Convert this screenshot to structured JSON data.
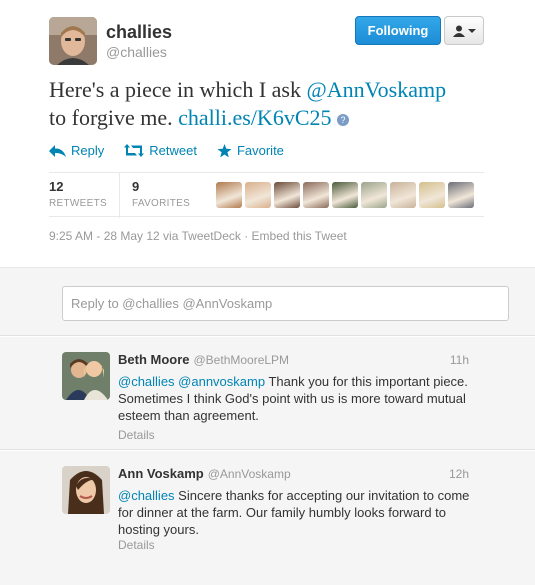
{
  "main_tweet": {
    "author_name": "challies",
    "author_handle": "@challies",
    "following_label": "Following",
    "text_part1": "Here's a piece in which I ask ",
    "mention": "@AnnVoskamp",
    "text_part2": "to forgive me. ",
    "link": "challi.es/K6vC25",
    "actions": {
      "reply": "Reply",
      "retweet": "Retweet",
      "favorite": "Favorite"
    },
    "stats": {
      "retweets_count": "12",
      "retweets_label": "RETWEETS",
      "favorites_count": "9",
      "favorites_label": "FAVORITES"
    },
    "favoriter_avatar_colors": [
      "#b07a4e",
      "#d9b08c",
      "#6b4b3a",
      "#8a6a5a",
      "#4a5a3a",
      "#9aa48a",
      "#c8b29a",
      "#d4c08c",
      "#6a6e78"
    ],
    "meta": "9:25 AM - 28 May 12 via TweetDeck · Embed this Tweet"
  },
  "reply_box": {
    "placeholder": "Reply to @challies @AnnVoskamp"
  },
  "replies": [
    {
      "name": "Beth Moore",
      "handle": "@BethMooreLPM",
      "time": "11h",
      "mentions": "@challies @annvoskamp",
      "text": " Thank you for this important piece. Sometimes I think God's point with us is more toward mutual esteem than agreement.",
      "details": "Details"
    },
    {
      "name": "Ann Voskamp",
      "handle": "@AnnVoskamp",
      "time": "12h",
      "mentions": "@challies",
      "text": " Sincere thanks for accepting our invitation to come for dinner at the farm. Our family humbly looks forward to hosting yours.",
      "details": "Details"
    }
  ],
  "colors": {
    "link": "#0084b4",
    "following_button": "#1d8dd6",
    "muted": "#999999"
  }
}
